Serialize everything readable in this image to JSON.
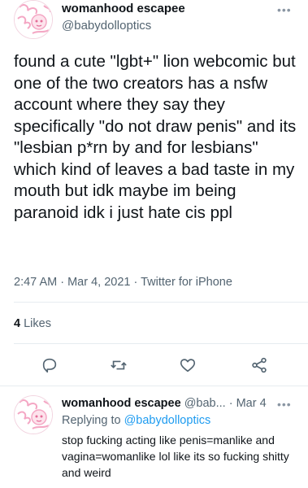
{
  "main_tweet": {
    "display_name": "womanhood escapee",
    "handle": "@babydolloptics",
    "more_label": "•••",
    "text": "found a cute \"lgbt+\" lion webcomic but one of the two creators has a nsfw account where they say they specifically \"do not draw penis\" and its \"lesbian p*rn by and for lesbians\" which kind of leaves a bad taste in my mouth but idk maybe im being paranoid idk i just hate cis ppl",
    "timestamp": "2:47 AM · Mar 4, 2021 · Twitter for iPhone",
    "likes_count": "4",
    "likes_label": "Likes"
  },
  "actions": [
    {
      "name": "reply-icon"
    },
    {
      "name": "retweet-icon"
    },
    {
      "name": "like-icon"
    },
    {
      "name": "share-icon"
    }
  ],
  "reply_tweet": {
    "display_name": "womanhood escapee",
    "handle_date": "@bab... · Mar 4",
    "more_label": "•••",
    "replying_prefix": "Replying to",
    "replying_handle": "@babydolloptics",
    "text": "stop fucking acting like penis=manlike and vagina=womanlike lol like its so fucking shitty and weird"
  },
  "colors": {
    "accent": "#1d9bf0",
    "secondary_text": "#536471",
    "avatar_pink": "#f4a7c4"
  }
}
